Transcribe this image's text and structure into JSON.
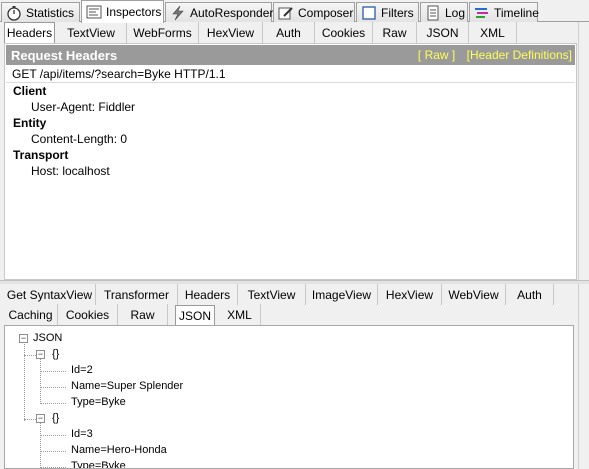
{
  "main_tabs": [
    {
      "label": "Statistics",
      "icon": "stopwatch-icon"
    },
    {
      "label": "Inspectors",
      "icon": "inspectors-icon"
    },
    {
      "label": "AutoResponder",
      "icon": "lightning-icon"
    },
    {
      "label": "Composer",
      "icon": "composer-icon"
    },
    {
      "label": "Filters",
      "icon": "checkbox-icon"
    },
    {
      "label": "Log",
      "icon": "log-icon"
    },
    {
      "label": "Timeline",
      "icon": "timeline-icon"
    }
  ],
  "request_tabs": [
    "Headers",
    "TextView",
    "WebForms",
    "HexView",
    "Auth",
    "Cookies",
    "Raw",
    "JSON",
    "XML"
  ],
  "request": {
    "title": "Request Headers",
    "raw_link": "[ Raw ]",
    "defs_link": "[Header Definitions]",
    "request_line": "GET /api/items/?search=Byke HTTP/1.1",
    "groups": [
      {
        "name": "Client",
        "headers": [
          "User-Agent: Fiddler"
        ]
      },
      {
        "name": "Entity",
        "headers": [
          "Content-Length: 0"
        ]
      },
      {
        "name": "Transport",
        "headers": [
          "Host: localhost"
        ]
      }
    ]
  },
  "response_tabs_row1": [
    "Get SyntaxView",
    "Transformer",
    "Headers",
    "TextView",
    "ImageView",
    "HexView",
    "WebView",
    "Auth"
  ],
  "response_tabs_row2": [
    "Caching",
    "Cookies",
    "Raw",
    "JSON",
    "XML"
  ],
  "json_tree": {
    "root": "JSON",
    "object_label": "{}",
    "items": [
      [
        "Id=2",
        "Name=Super Splender",
        "Type=Byke"
      ],
      [
        "Id=3",
        "Name=Hero-Honda",
        "Type=Byke"
      ]
    ]
  },
  "colors": {
    "header_bar": "#9a9a9a",
    "header_links": "#ffff55",
    "selected_tab": "#ffffff"
  }
}
